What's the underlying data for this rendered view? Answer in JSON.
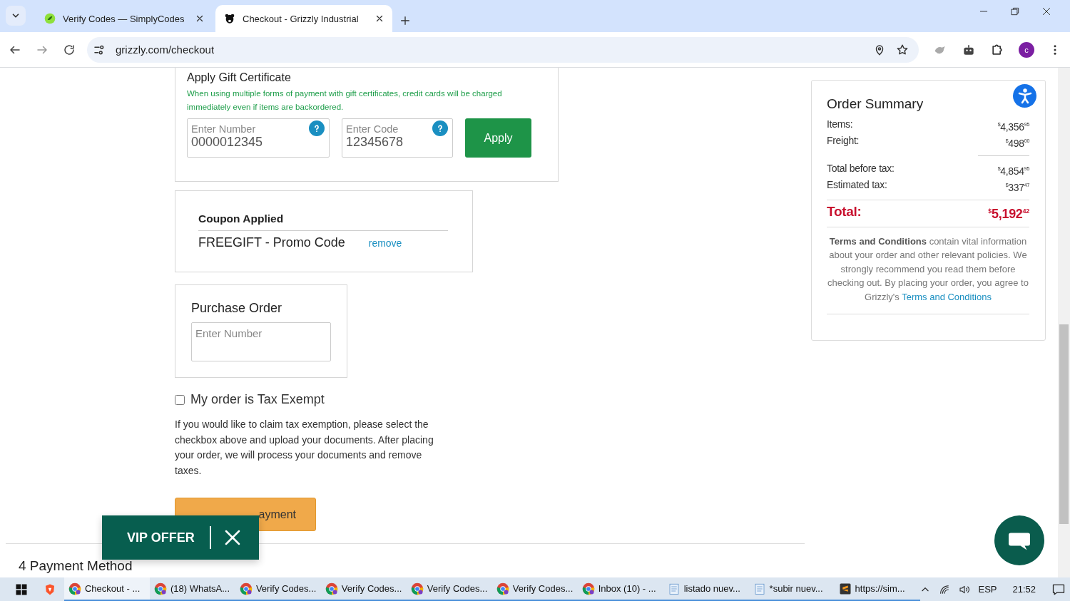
{
  "browser": {
    "tabs": [
      {
        "title": "Verify Codes — SimplyCodes",
        "selected": false,
        "kind": "simplycodes"
      },
      {
        "title": "Checkout - Grizzly Industrial",
        "selected": true,
        "kind": "bear"
      }
    ],
    "url": "grizzly.com/checkout",
    "profile_initial": "c"
  },
  "gift_certificate": {
    "title": "Apply Gift Certificate",
    "notice": "When using multiple forms of payment with gift certificates, credit cards will be charged immediately even if items are backordered.",
    "fields": [
      {
        "placeholder": "Enter Number",
        "value": "0000012345"
      },
      {
        "placeholder": "Enter Code",
        "value": "12345678"
      }
    ],
    "button": "Apply"
  },
  "coupon": {
    "title": "Coupon Applied",
    "code": "FREEGIFT - Promo Code",
    "remove_link": "remove"
  },
  "purchase_order": {
    "title": "Purchase Order",
    "placeholder": "Enter Number"
  },
  "tax_exempt": {
    "label": "My order is Tax Exempt",
    "checked": false,
    "note": "If you would like to claim tax exemption, please select the checkbox above and upload your documents. After placing your order, we will process your documents and remove taxes."
  },
  "proceed_button": "ayment",
  "next_step": "4 Payment Method",
  "vip_offer": {
    "label": "VIP OFFER"
  },
  "order_summary": {
    "title": "Order Summary",
    "groups": [
      [
        {
          "label": "Items:",
          "currency": "$",
          "whole": "4,356",
          "cents": "95"
        },
        {
          "label": "Freight:",
          "currency": "$",
          "whole": "498",
          "cents": "00"
        }
      ],
      [
        {
          "label": "Total before tax:",
          "currency": "$",
          "whole": "4,854",
          "cents": "95"
        },
        {
          "label": "Estimated tax:",
          "currency": "$",
          "whole": "337",
          "cents": "47"
        }
      ]
    ],
    "total": {
      "label": "Total:",
      "currency": "$",
      "whole": "5,192",
      "cents": "42"
    },
    "terms_bold": "Terms and Conditions",
    "terms_text": " contain vital information about your order and other relevant policies. We strongly recommend you read them before checking out. By placing your order, you agree to Grizzly's ",
    "terms_link": "Terms and Conditions"
  },
  "taskbar": {
    "items": [
      {
        "label": "Checkout - ...",
        "kind": "chrome",
        "selected": true
      },
      {
        "label": "(18) WhatsA...",
        "kind": "chrome",
        "selected": false
      },
      {
        "label": "Verify Codes...",
        "kind": "chrome",
        "selected": false
      },
      {
        "label": "Verify Codes...",
        "kind": "chrome",
        "selected": false
      },
      {
        "label": "Verify Codes...",
        "kind": "chrome",
        "selected": false
      },
      {
        "label": "Verify Codes...",
        "kind": "chrome",
        "selected": false
      },
      {
        "label": "Inbox (10) - ...",
        "kind": "chrome",
        "selected": false
      },
      {
        "label": "listado nuev...",
        "kind": "notepad",
        "selected": false
      },
      {
        "label": "*subir nuev...",
        "kind": "notepad",
        "selected": false
      },
      {
        "label": "https://sim...",
        "kind": "sublime",
        "selected": false
      }
    ],
    "language": "ESP",
    "time": "21:52"
  }
}
